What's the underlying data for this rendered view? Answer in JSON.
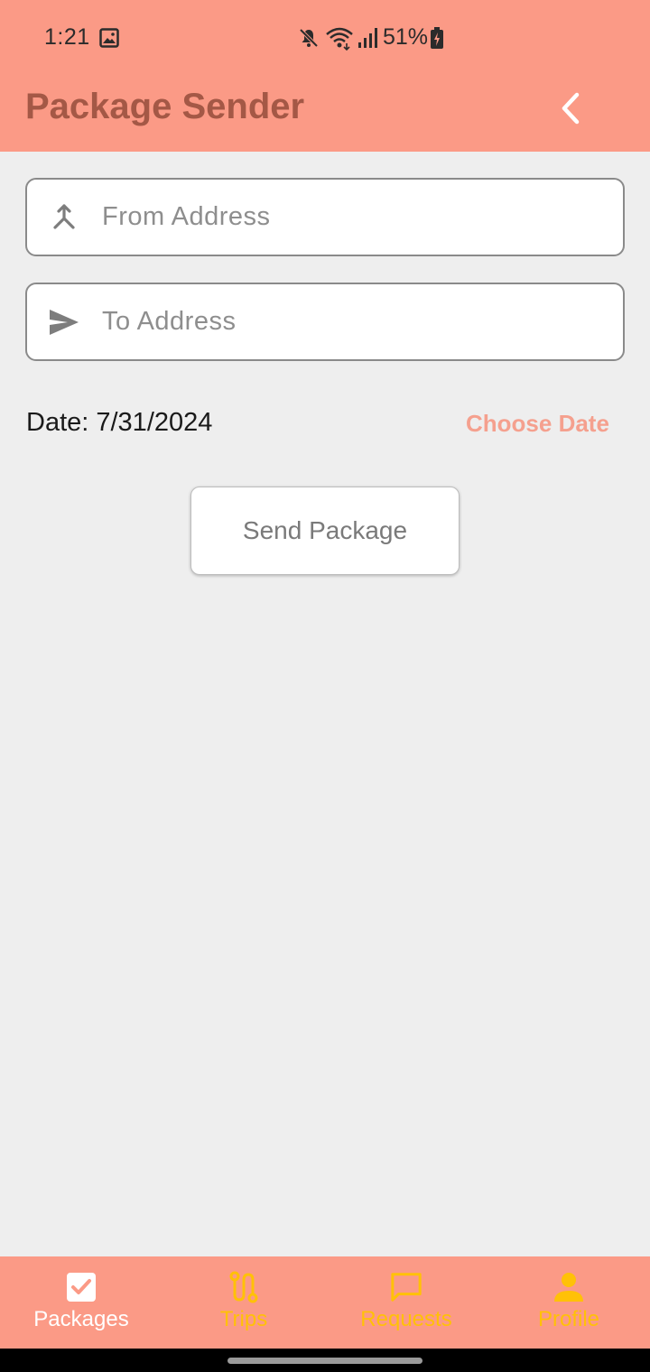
{
  "status_bar": {
    "time": "1:21",
    "battery": "51%"
  },
  "header": {
    "title": "Package Sender"
  },
  "form": {
    "from_placeholder": "From Address",
    "from_value": "",
    "to_placeholder": "To Address",
    "to_value": "",
    "date_label": "Date: 7/31/2024",
    "choose_date_label": "Choose Date",
    "send_label": "Send Package"
  },
  "bottom_nav": {
    "items": [
      {
        "label": "Packages",
        "icon": "checkbox-icon",
        "active": true
      },
      {
        "label": "Trips",
        "icon": "route-icon",
        "active": false
      },
      {
        "label": "Requests",
        "icon": "message-icon",
        "active": false
      },
      {
        "label": "Profile",
        "icon": "person-icon",
        "active": false
      }
    ]
  },
  "colors": {
    "accent": "#fb9a86",
    "title": "#a45846",
    "nav_inactive": "#ffc107",
    "link": "#f5a08e"
  }
}
